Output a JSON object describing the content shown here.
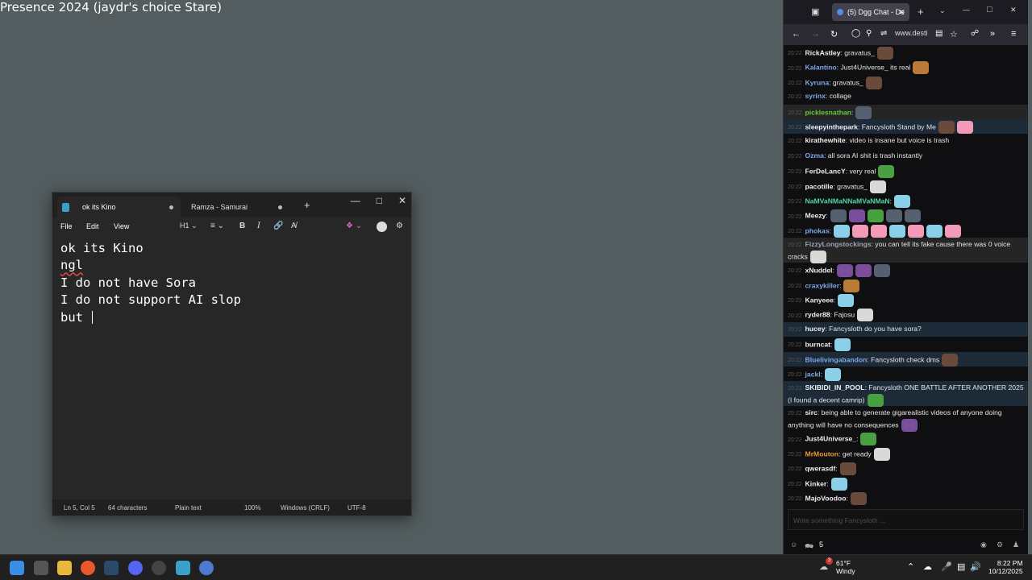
{
  "obs_title": "Presence 2024 (jaydr's choice Stare)",
  "notepad": {
    "tabs": [
      {
        "label": "ok its Kino"
      },
      {
        "label": "Ramza - Samurai"
      }
    ],
    "menu": [
      "File",
      "Edit",
      "View"
    ],
    "heading_label": "H1",
    "lines": [
      "ok its Kino",
      "ngl",
      "I do not have Sora",
      "I do not support AI slop",
      "but "
    ],
    "status": {
      "position": "Ln 5, Col 5",
      "chars": "64 characters",
      "format": "Plain text",
      "zoom": "100%",
      "eol": "Windows (CRLF)",
      "encoding": "UTF-8"
    }
  },
  "browser": {
    "tab_title": "(5) Dgg Chat - De",
    "url": "www.desti",
    "messages": [
      {
        "time": "20:22",
        "user": "RickAstley",
        "text": ": gravatus_",
        "emotes": [
          "e1"
        ]
      },
      {
        "time": "20:22",
        "user": "Kalantino",
        "color": "blue",
        "text": ": Just4Universe_ its real",
        "emotes": [
          "e3"
        ]
      },
      {
        "time": "20:22",
        "user": "Kyruna",
        "color": "blue",
        "text": ": gravatus_",
        "emotes": [
          "e1"
        ]
      },
      {
        "time": "20:22",
        "user": "syrinx",
        "color": "blue",
        "text": ": collage",
        "emotes": []
      },
      {
        "time": "20:22",
        "user": "picklesnathan",
        "color": "green",
        "text": ":",
        "emotes": [
          "e8"
        ],
        "hl": "hl2"
      },
      {
        "time": "20:22",
        "user": "sleepyinthepark",
        "text": ": Fancysloth Stand by Me",
        "emotes": [
          "e1",
          "e7"
        ],
        "hl": "hl"
      },
      {
        "time": "20:22",
        "user": "kirathewhite",
        "text": ": video is insane but voice is trash",
        "emotes": []
      },
      {
        "time": "20:22",
        "user": "Ozma",
        "color": "blue",
        "text": ": all sora AI shit is trash instantly",
        "emotes": []
      },
      {
        "time": "20:22",
        "user": "FerDeLancY",
        "text": ": very real",
        "emotes": [
          "e6"
        ]
      },
      {
        "time": "20:22",
        "user": "pacotille",
        "text": ": gravatus_",
        "emotes": [
          "e4"
        ]
      },
      {
        "time": "20:22",
        "user": "NaMVaNMaNNaMVaNMaN",
        "color": "teal",
        "text": ":",
        "emotes": [
          "e2"
        ]
      },
      {
        "time": "20:22",
        "user": "Meezy",
        "text": ":",
        "emotes": [
          "e8",
          "e5",
          "e6",
          "e8",
          "e8"
        ]
      },
      {
        "time": "20:22",
        "user": "phokas",
        "color": "blue",
        "text": ":",
        "emotes": [
          "e2",
          "e7",
          "e7",
          "e2",
          "e7",
          "e2",
          "e7"
        ]
      },
      {
        "time": "20:22",
        "user": "FizzyLongstockings",
        "color": "gray",
        "text": ": you can tell its fake cause there was 0 voice cracks",
        "emotes": [
          "e4"
        ],
        "hl": "hl2",
        "two": true
      },
      {
        "time": "20:22",
        "user": "xNuddel",
        "text": ":",
        "emotes": [
          "e5",
          "e5",
          "e8"
        ]
      },
      {
        "time": "20:22",
        "user": "craxykiller",
        "color": "blue",
        "text": ":",
        "emotes": [
          "e3"
        ]
      },
      {
        "time": "20:22",
        "user": "Kanyeee",
        "text": ":",
        "emotes": [
          "e2"
        ]
      },
      {
        "time": "20:22",
        "user": "ryder88",
        "text": ": Fajosu",
        "emotes": [
          "e4"
        ]
      },
      {
        "time": "20:22",
        "user": "hucey",
        "text": ": Fancysloth do you have sora?",
        "emotes": [],
        "hl": "hl"
      },
      {
        "time": "20:22",
        "user": "burncat",
        "text": ":",
        "emotes": [
          "e2"
        ]
      },
      {
        "time": "20:22",
        "user": "Bluelivingabandon",
        "color": "blue",
        "text": ": Fancysloth check dms",
        "emotes": [
          "e1"
        ],
        "hl": "hl"
      },
      {
        "time": "20:22",
        "user": "jackl",
        "color": "blue",
        "text": ":",
        "emotes": [
          "e2"
        ]
      },
      {
        "time": "20:22",
        "user": "SKIBIDI_IN_POOL",
        "text": ": Fancysloth ONE BATTLE AFTER ANOTHER 2025 (I found a decent camrip)",
        "emotes": [
          "e6"
        ],
        "hl": "hl",
        "two": true
      },
      {
        "time": "20:22",
        "user": "sirc",
        "text": ": being able to generate gigarealistic videos of anyone doing anything will have no consequences",
        "emotes": [
          "e5"
        ],
        "two": true
      },
      {
        "time": "20:22",
        "user": "Just4Universe_",
        "text": ":",
        "emotes": [
          "e6"
        ]
      },
      {
        "time": "20:22",
        "user": "MrMouton",
        "color": "orange",
        "text": ": get ready",
        "emotes": [
          "e4"
        ]
      },
      {
        "time": "20:22",
        "user": "qwerasdf",
        "text": ":",
        "emotes": [
          "e1"
        ]
      },
      {
        "time": "20:22",
        "user": "Kinker",
        "text": ":",
        "emotes": [
          "e2"
        ]
      },
      {
        "time": "20:22",
        "user": "MajoVoodoo",
        "text": ":",
        "emotes": [
          "e1"
        ]
      }
    ],
    "input_placeholder": "Write something Fancysloth ...",
    "user_count": "5"
  },
  "taskbar": {
    "weather_temp": "61°F",
    "weather_desc": "Windy",
    "weather_badge": "3",
    "time": "8:22 PM",
    "date": "10/12/2025"
  }
}
